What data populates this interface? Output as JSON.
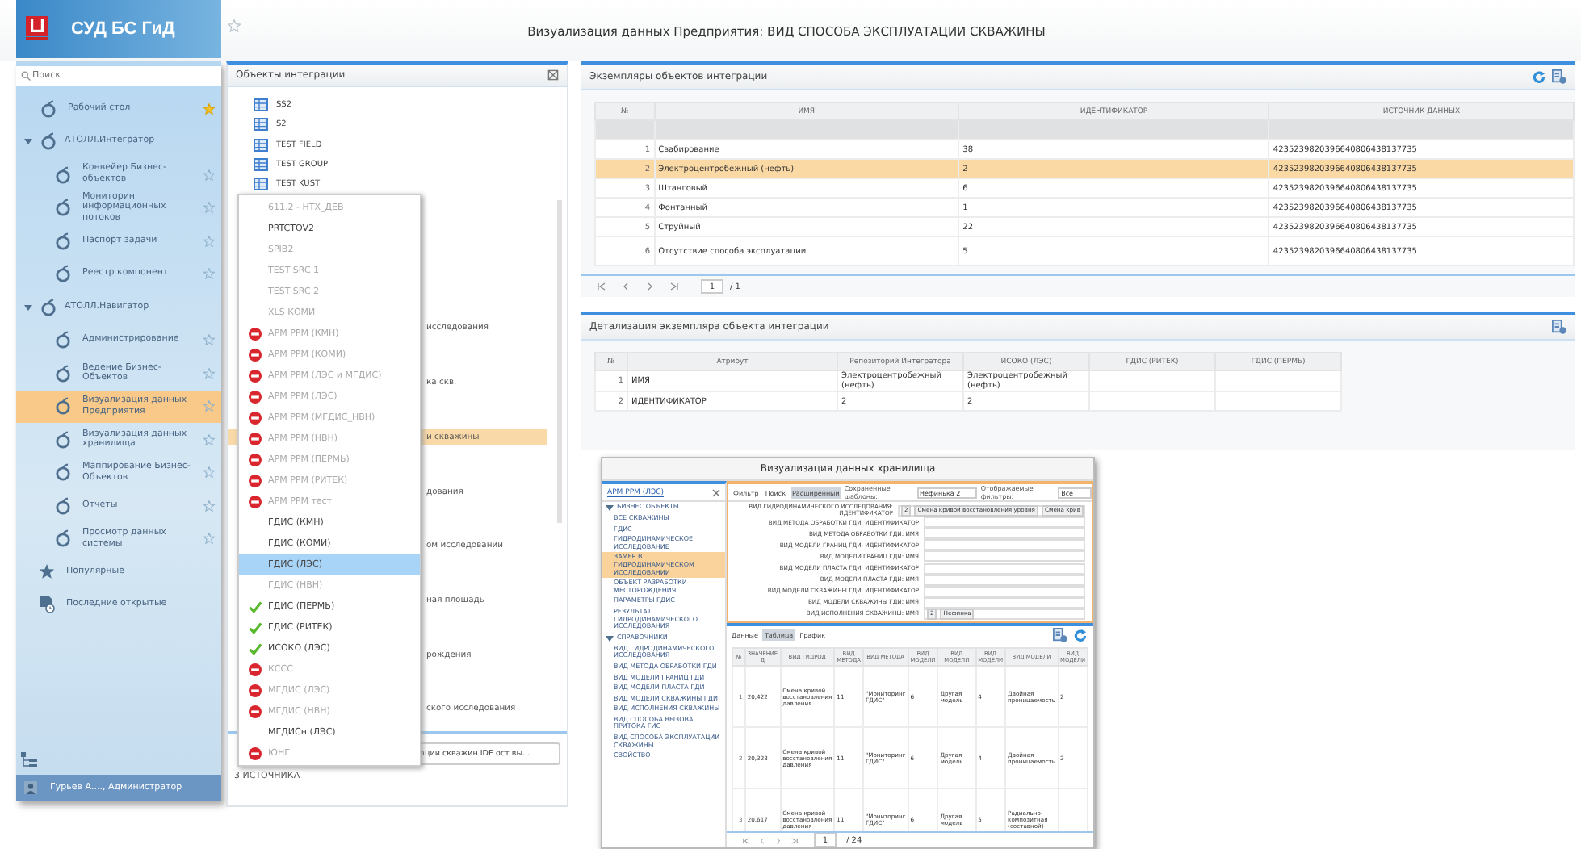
{
  "header": {
    "app_title": "СУД БС ГиД",
    "page_title": "Визуализация данных Предприятия: ВИД СПОСОБА ЭКСПЛУАТАЦИИ СКВАЖИНЫ"
  },
  "sidebar": {
    "search": {
      "placeholder": "Поиск"
    },
    "items": [
      {
        "label": "Рабочий стол",
        "favorite": true,
        "selected": false
      },
      {
        "label": "АТОЛЛ.Интегратор",
        "expanded": true,
        "children": [
          {
            "label": "Конвейер Бизнес-объектов",
            "favorite": false,
            "selected": false
          },
          {
            "label": "Мониторинг информационных потоков",
            "favorite": false,
            "selected": false
          },
          {
            "label": "Паспорт задачи",
            "favorite": false,
            "selected": false
          },
          {
            "label": "Реестр компонент",
            "favorite": false,
            "selected": false
          }
        ]
      },
      {
        "label": "АТОЛЛ.Навигатор",
        "expanded": true,
        "children": [
          {
            "label": "Администрирование",
            "favorite": false,
            "selected": false
          },
          {
            "label": "Ведение Бизнес-Объектов",
            "favorite": false,
            "selected": false
          },
          {
            "label": "Визуализация данных Предприятия",
            "favorite": false,
            "selected": true
          },
          {
            "label": "Визуализация данных хранилища",
            "favorite": false,
            "selected": false
          },
          {
            "label": "Маппирование Бизнес-Объектов",
            "favorite": false,
            "selected": false
          },
          {
            "label": "Отчеты",
            "favorite": false,
            "selected": false
          },
          {
            "label": "Просмотр данных системы",
            "favorite": false,
            "selected": false
          }
        ]
      }
    ],
    "shortcuts": [
      {
        "label": "Популярные",
        "kind": "popular"
      },
      {
        "label": "Последние открытые",
        "kind": "recent"
      }
    ],
    "user": "Гурьев А...., Администратор"
  },
  "integration_panel": {
    "title": "Объекты интеграции",
    "tree": [
      {
        "label": "SS2",
        "kind": "table",
        "selected": false
      },
      {
        "label": "S2",
        "kind": "table",
        "selected": false
      },
      {
        "label": "TEST FIELD",
        "kind": "table",
        "selected": false
      },
      {
        "label": "TEST GROUP",
        "kind": "table",
        "selected": false
      },
      {
        "label": "TEST KUST",
        "kind": "table",
        "selected": false
      },
      {
        "label": "исследования",
        "kind": "fragment",
        "selected": false
      },
      {
        "label": "ка скв.",
        "kind": "fragment",
        "selected": false
      },
      {
        "label": "и скважины",
        "kind": "fragment",
        "selected": true
      },
      {
        "label": "дования",
        "kind": "fragment",
        "selected": false
      },
      {
        "label": "ом исследовании",
        "kind": "fragment",
        "selected": false
      },
      {
        "label": "ная площадь",
        "kind": "fragment",
        "selected": false
      },
      {
        "label": "рождения",
        "kind": "fragment",
        "selected": false
      },
      {
        "label": "ского исследования",
        "kind": "fragment",
        "selected": false
      }
    ],
    "source_field": "ации скважин IDE ост вы...",
    "count": "3 ИСТОЧНИКА"
  },
  "source_dropdown": {
    "items": [
      {
        "label": "611.2 - НТХ_ДЕВ",
        "kind": "plain",
        "disabled": true,
        "selected": false
      },
      {
        "label": "PRTCTOV2",
        "kind": "plain",
        "disabled": false,
        "selected": false
      },
      {
        "label": "SPIB2",
        "kind": "plain",
        "disabled": true,
        "selected": false
      },
      {
        "label": "TEST SRC 1",
        "kind": "plain",
        "disabled": true,
        "selected": false
      },
      {
        "label": "TEST SRC 2",
        "kind": "plain",
        "disabled": true,
        "selected": false
      },
      {
        "label": "XLS КОМИ",
        "kind": "plain",
        "disabled": true,
        "selected": false
      },
      {
        "label": "АРМ РРМ (КМН)",
        "kind": "error",
        "disabled": true,
        "selected": false
      },
      {
        "label": "АРМ РРМ (КОМИ)",
        "kind": "error",
        "disabled": true,
        "selected": false
      },
      {
        "label": "АРМ РРМ (ЛЭС и МГДИС)",
        "kind": "error",
        "disabled": true,
        "selected": false
      },
      {
        "label": "АРМ РРМ (ЛЭС)",
        "kind": "error",
        "disabled": true,
        "selected": false
      },
      {
        "label": "АРМ РРМ (МГДИС_НВН)",
        "kind": "error",
        "disabled": true,
        "selected": false
      },
      {
        "label": "АРМ РРМ (НВН)",
        "kind": "error",
        "disabled": true,
        "selected": false
      },
      {
        "label": "АРМ РРМ (ПЕРМЬ)",
        "kind": "error",
        "disabled": true,
        "selected": false
      },
      {
        "label": "АРМ РРМ (РИТЕК)",
        "kind": "error",
        "disabled": true,
        "selected": false
      },
      {
        "label": "АРМ РРМ тест",
        "kind": "error",
        "disabled": true,
        "selected": false
      },
      {
        "label": "ГДИС (КМН)",
        "kind": "plain",
        "disabled": false,
        "selected": false
      },
      {
        "label": "ГДИС (КОМИ)",
        "kind": "plain",
        "disabled": false,
        "selected": false
      },
      {
        "label": "ГДИС (ЛЭС)",
        "kind": "plain",
        "disabled": false,
        "selected": true
      },
      {
        "label": "ГДИС (НВН)",
        "kind": "plain",
        "disabled": true,
        "selected": false
      },
      {
        "label": "ГДИС (ПЕРМЬ)",
        "kind": "ok",
        "disabled": false,
        "selected": false
      },
      {
        "label": "ГДИС (РИТЕК)",
        "kind": "ok",
        "disabled": false,
        "selected": false
      },
      {
        "label": "ИСОКО (ЛЭС)",
        "kind": "ok",
        "disabled": false,
        "selected": false
      },
      {
        "label": "КССС",
        "kind": "error",
        "disabled": true,
        "selected": false
      },
      {
        "label": "МГДИС (ЛЭС)",
        "kind": "error",
        "disabled": true,
        "selected": false
      },
      {
        "label": "МГДИС (НВН)",
        "kind": "error",
        "disabled": true,
        "selected": false
      },
      {
        "label": "МГДИСн (ЛЭС)",
        "kind": "plain",
        "disabled": false,
        "selected": false
      },
      {
        "label": "ЮНГ",
        "kind": "error",
        "disabled": true,
        "selected": false
      }
    ]
  },
  "instances": {
    "title": "Экземпляры объектов интеграции",
    "columns": [
      "№",
      "ИМЯ",
      "ИДЕНТИФИКАТОР",
      "ИСТОЧНИК ДАННЫХ"
    ],
    "rows": [
      {
        "cells": [
          "1",
          "Свабирование",
          "38",
          "4235239820396640806438137735"
        ],
        "selected": false
      },
      {
        "cells": [
          "2",
          "Электроцентробежный (нефть)",
          "2",
          "4235239820396640806438137735"
        ],
        "selected": true
      },
      {
        "cells": [
          "3",
          "Штанговый",
          "6",
          "4235239820396640806438137735"
        ],
        "selected": false
      },
      {
        "cells": [
          "4",
          "Фонтанный",
          "1",
          "4235239820396640806438137735"
        ],
        "selected": false
      },
      {
        "cells": [
          "5",
          "Струйный",
          "22",
          "4235239820396640806438137735"
        ],
        "selected": false
      },
      {
        "cells": [
          "6",
          "Отсутствие способа эксплуатации",
          "5",
          "4235239820396640806438137735"
        ],
        "selected": false
      }
    ],
    "pager": {
      "page": "1",
      "total": "/ 1"
    }
  },
  "detail": {
    "title": "Детализация экземпляра объекта интеграции",
    "columns": [
      "№",
      "Атрибут",
      "Репозиторий Интегратора",
      "ИСОКО (ЛЭС)",
      "ГДИС (РИТЕК)",
      "ГДИС (ПЕРМЬ)"
    ],
    "rows": [
      [
        "1",
        "ИМЯ",
        "Электроцентробежный (нефть)",
        "Электроцентробежный (нефть)"
      ],
      [
        "2",
        "ИДЕНТИФИКАТОР",
        "2",
        "2"
      ]
    ]
  },
  "storage_window": {
    "title": "Визуализация данных хранилища",
    "source": "АРМ РРМ (ЛЭС)",
    "tree": [
      {
        "label": "БИЗНЕС ОБЪЕКТЫ",
        "expanded": true,
        "selected": false,
        "children": [
          {
            "label": "ВСЕ СКВАЖИНЫ",
            "selected": false
          },
          {
            "label": "ГДИС",
            "selected": false
          },
          {
            "label": "ГИДРОДИНАМИЧЕСКОЕ ИССЛЕДОВАНИЕ",
            "selected": false
          },
          {
            "label": "ЗАМЕР В ГИДРОДИНАМИЧЕСКОМ ИССЛЕДОВАНИИ",
            "selected": true
          },
          {
            "label": "ОБЪЕКТ РАЗРАБОТКИ МЕСТОРОЖДЕНИЯ",
            "selected": false
          },
          {
            "label": "ПАРАМЕТРЫ ГДИС",
            "selected": false
          },
          {
            "label": "РЕЗУЛЬТАТ ГИДРОДИНАМИЧЕСКОГО ИССЛЕДОВАНИЯ",
            "selected": false
          }
        ]
      },
      {
        "label": "СПРАВОЧНИКИ",
        "expanded": true,
        "selected": false,
        "children": [
          {
            "label": "ВИД ГИДРОДИНАМИЧЕСКОГО ИССЛЕДОВАНИЯ",
            "selected": false
          },
          {
            "label": "ВИД МЕТОДА ОБРАБОТКИ ГДИ",
            "selected": false
          },
          {
            "label": "ВИД МОДЕЛИ ГРАНИЦ ГДИ",
            "selected": false
          },
          {
            "label": "ВИД МОДЕЛИ ПЛАСТА ГДИ",
            "selected": false
          },
          {
            "label": "ВИД МОДЕЛИ СКВАЖИНЫ ГДИ",
            "selected": false
          },
          {
            "label": "ВИД ИСПОЛНЕНИЯ СКВАЖИНЫ",
            "selected": false
          },
          {
            "label": "ВИД СПОСОБА ВЫЗОВА ПРИТОКА ГИС",
            "selected": false
          },
          {
            "label": "ВИД СПОСОБА ЭКСПЛУАТАЦИИ СКВАЖИНЫ",
            "selected": false
          },
          {
            "label": "СВОЙСТВО",
            "selected": false
          }
        ]
      }
    ],
    "filter_tabs": [
      {
        "label": "Фильтр",
        "selected": false
      },
      {
        "label": "Поиск",
        "selected": false
      },
      {
        "label": "Расширенный",
        "selected": true
      }
    ],
    "templates_label": "Сохраненные шаблоны:",
    "template": "Нефинька 2",
    "shown_filters_label": "Отображаемые фильтры:",
    "shown_filters": "Все",
    "filters": [
      {
        "label": "ВИД ГИДРОДИНАМИЧЕСКОГО ИССЛЕДОВАНИЯ: ИДЕНТИФИКАТОР",
        "values": [
          "2",
          "Смена кривой восстановления уровня",
          "Смена крив"
        ]
      },
      {
        "label": "ВИД МЕТОДА ОБРАБОТКИ ГДИ: ИДЕНТИФИКАТОР"
      },
      {
        "label": "ВИД МЕТОДА ОБРАБОТКИ ГДИ: ИМЯ"
      },
      {
        "label": "ВИД МОДЕЛИ ГРАНИЦ ГДИ: ИДЕНТИФИКАТОР"
      },
      {
        "label": "ВИД МОДЕЛИ ГРАНИЦ ГДИ: ИМЯ"
      },
      {
        "label": "ВИД МОДЕЛИ ПЛАСТА ГДИ: ИДЕНТИФИКАТОР"
      },
      {
        "label": "ВИД МОДЕЛИ ПЛАСТА ГДИ: ИМЯ"
      },
      {
        "label": "ВИД МОДЕЛИ СКВАЖИНЫ ГДИ: ИДЕНТИФИКАТОР"
      },
      {
        "label": "ВИД МОДЕЛИ СКВАЖИНЫ ГДИ: ИМЯ"
      },
      {
        "label": "ВИД ИСПОЛНЕНИЯ СКВАЖИНЫ: ИМЯ",
        "values": [
          "2",
          "Нефинка"
        ]
      }
    ],
    "data_tabs": [
      {
        "label": "Данные",
        "selected": false
      },
      {
        "label": "Таблица",
        "selected": true
      },
      {
        "label": "График",
        "selected": false
      }
    ],
    "grid": {
      "columns": [
        "№",
        "ЗНАЧЕНИЕ Д",
        "ВИД ГИДРОД",
        "ВИД МЕТОДА",
        "ВИД МЕТОДА",
        "ВИД МОДЕЛИ",
        "ВИД МОДЕЛИ",
        "ВИД МОДЕЛИ",
        "ВИД МОДЕЛИ",
        "ВИД МОДЕЛИ"
      ],
      "rows": [
        [
          "1",
          "20,422",
          "Смена кривой восстановления давления",
          "11",
          "\"Мониторинг ГДИС\"",
          "6",
          "Другая модель",
          "4",
          "Двойная проницаемость",
          "2"
        ],
        [
          "2",
          "20,328",
          "Смена кривой восстановления давления",
          "11",
          "\"Мониторинг ГДИС\"",
          "6",
          "Другая модель",
          "4",
          "Двойная проницаемость",
          "2"
        ],
        [
          "3",
          "20,617",
          "Смена кривой восстановления давления",
          "11",
          "\"Мониторинг ГДИС\"",
          "6",
          "Другая модель",
          "5",
          "Радиально-композитная (составной)"
        ]
      ]
    },
    "pager": {
      "page": "1",
      "total": "/ 24"
    }
  }
}
